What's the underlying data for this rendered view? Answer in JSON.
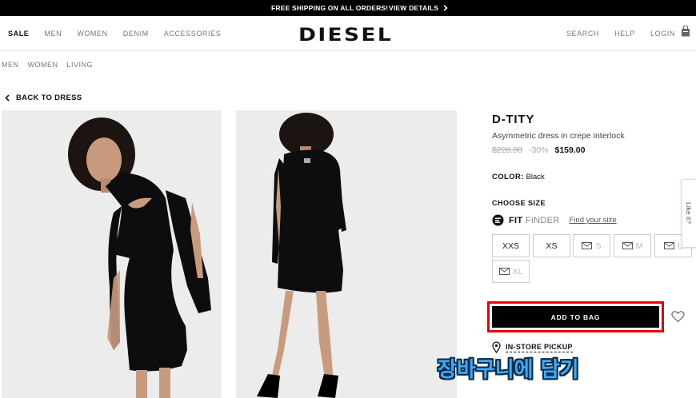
{
  "promo_bar": {
    "message": "FREE SHIPPING ON ALL ORDERS!",
    "details_link": "VIEW DETAILS"
  },
  "header": {
    "nav_left": [
      "SALE",
      "MEN",
      "WOMEN",
      "DENIM",
      "ACCESSORIES"
    ],
    "logo": "DIESEL",
    "nav_right": [
      "SEARCH",
      "HELP",
      "LOGIN"
    ],
    "bag_icon": "shopping-bag-icon"
  },
  "subnav": [
    "MEN",
    "WOMEN",
    "LIVING"
  ],
  "back_link": "BACK TO DRESS",
  "product": {
    "name": "D-TITY",
    "description": "Asymmetric dress in crepe interlock",
    "price_original": "$228.00",
    "discount": "-30%",
    "price_sale": "$159.00",
    "color_label": "COLOR:",
    "color_value": "Black",
    "size_heading": "CHOOSE SIZE",
    "fit_finder_bold": "FIT",
    "fit_finder_light": "FINDER",
    "fit_link": "Find your size",
    "sizes": [
      {
        "label": "XXS",
        "available": true
      },
      {
        "label": "XS",
        "available": true
      },
      {
        "label": "S",
        "available": false
      },
      {
        "label": "M",
        "available": false
      },
      {
        "label": "L",
        "available": false
      },
      {
        "label": "XL",
        "available": false
      }
    ],
    "add_to_bag": "ADD TO BAG",
    "in_store_pickup": "IN-STORE PICKUP"
  },
  "overlay_caption": "장바구니에 담기",
  "like_tab": "Like it?",
  "colors": {
    "accent_red": "#ea0000",
    "caption_blue": "#3fa9f5",
    "black": "#000000"
  }
}
